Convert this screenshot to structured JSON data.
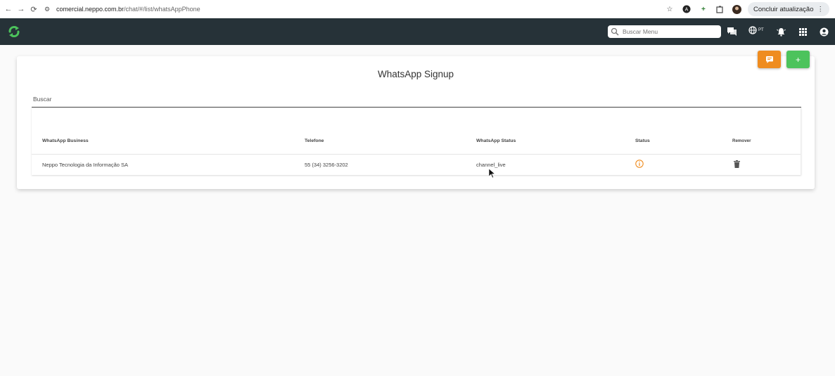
{
  "browser": {
    "url_host": "comercial.neppo.com.br",
    "url_path": "/chat/#/list/whatsAppPhone",
    "update_label": "Concluir atualização"
  },
  "header": {
    "search_placeholder": "Buscar Menu",
    "lang_label": "PT"
  },
  "page": {
    "title": "WhatsApp Signup",
    "search_placeholder": "Buscar"
  },
  "table": {
    "headers": [
      "WhatsApp Business",
      "Telefone",
      "WhatsApp Status",
      "Status",
      "Remover"
    ],
    "rows": [
      {
        "business": "Neppo Tecnologia da Informação SA",
        "phone": "55 (34) 3256-3202",
        "wa_status": "channel_live",
        "status_icon": "info-icon",
        "remove_icon": "trash-icon"
      }
    ]
  },
  "colors": {
    "header_bg": "#263238",
    "accent_orange": "#ef8c1f",
    "accent_green": "#4cc35c",
    "logo_green": "#4cc35c"
  },
  "fabs": {
    "chat_icon": "chat-icon",
    "add_label": "+"
  }
}
